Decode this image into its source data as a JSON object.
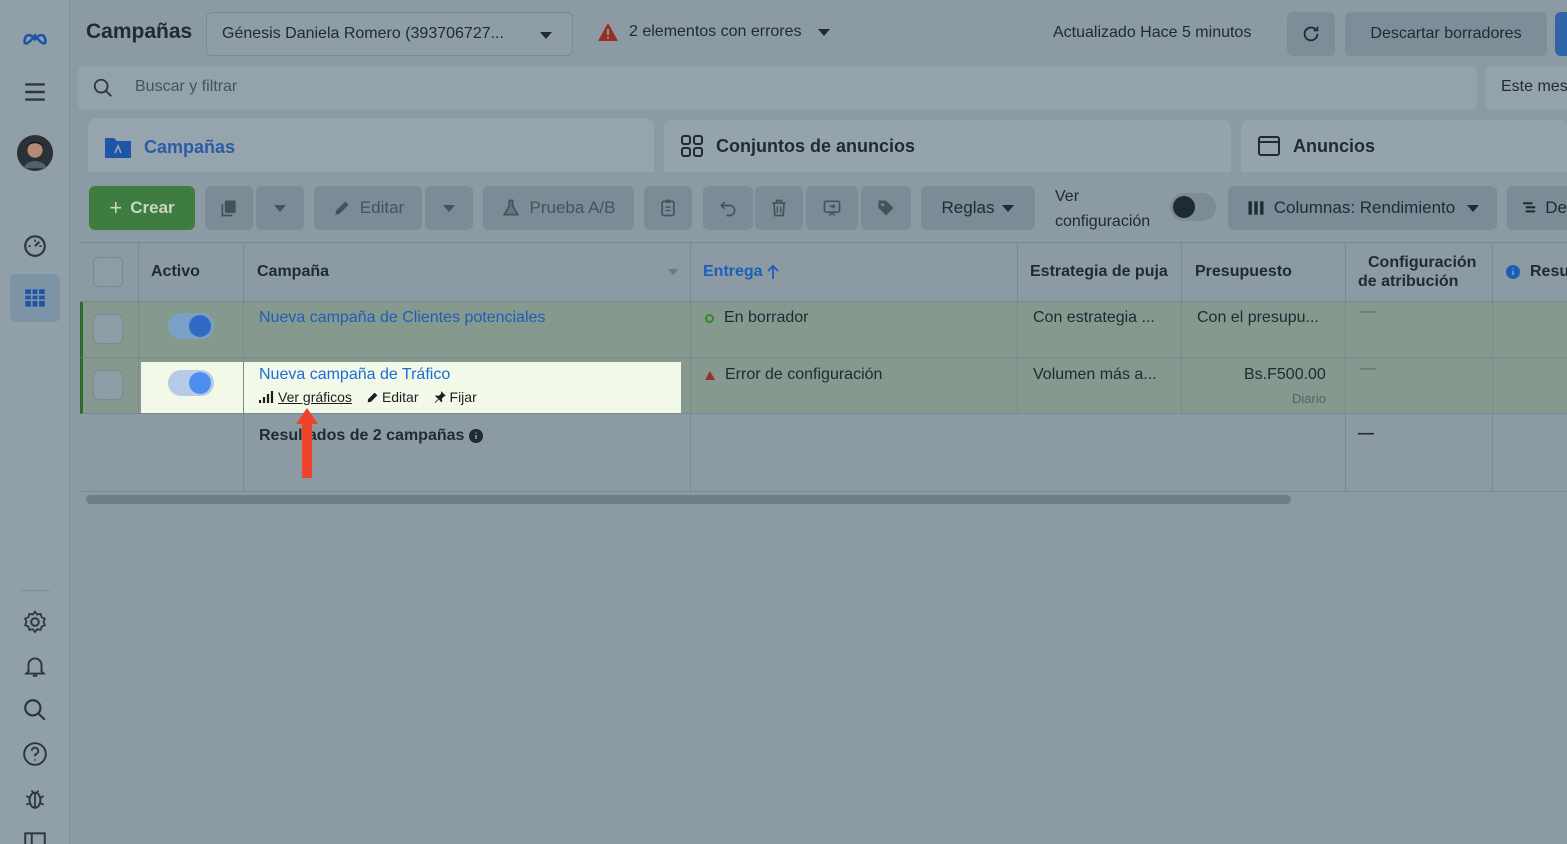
{
  "header": {
    "title": "Campañas",
    "account": "Génesis Daniela Romero (393706727...",
    "errors": "2 elementos con errores",
    "updated": "Actualizado Hace 5 minutos",
    "discard": "Descartar borradores"
  },
  "search": {
    "placeholder": "Buscar y filtrar",
    "date_range": "Este mes"
  },
  "tabs": [
    {
      "label": "Campañas",
      "icon": "folder-icon",
      "active": true
    },
    {
      "label": "Conjuntos de anuncios",
      "icon": "grid-icon",
      "active": false
    },
    {
      "label": "Anuncios",
      "icon": "window-icon",
      "active": false
    }
  ],
  "toolbar": {
    "create": "Crear",
    "edit": "Editar",
    "ab_test": "Prueba A/B",
    "rules": "Reglas",
    "view_settings": "Ver configuración",
    "columns": "Columnas: Rendimiento",
    "breakdown": "De"
  },
  "table": {
    "headers": {
      "active": "Activo",
      "campaign": "Campaña",
      "delivery": "Entrega",
      "bid_strategy": "Estrategia de puja",
      "budget": "Presupuesto",
      "attribution_1": "Configuración",
      "attribution_2": "de atribución",
      "results": "Resu"
    },
    "rows": [
      {
        "name": "Nueva campaña de Clientes potenciales",
        "delivery": "En borrador",
        "bid_strategy": "Con estrategia ...",
        "budget": "Con el presupu...",
        "attribution": "—"
      },
      {
        "name": "Nueva campaña de Tráfico",
        "delivery": "Error de configuración",
        "bid_strategy": "Volumen más a...",
        "budget": "Bs.F500.00",
        "budget_period": "Diario",
        "attribution": "—",
        "actions": {
          "charts": "Ver gráficos",
          "edit": "Editar",
          "pin": "Fijar"
        }
      }
    ],
    "summary": {
      "label": "Resultados de 2 campañas",
      "attribution": "—"
    }
  },
  "colors": {
    "accent": "#1a6cd6",
    "create": "#42b72a",
    "error": "#e4433b",
    "draft": "#42b72a",
    "highlight": "#f3f9e9",
    "arrow": "#f0442a"
  }
}
